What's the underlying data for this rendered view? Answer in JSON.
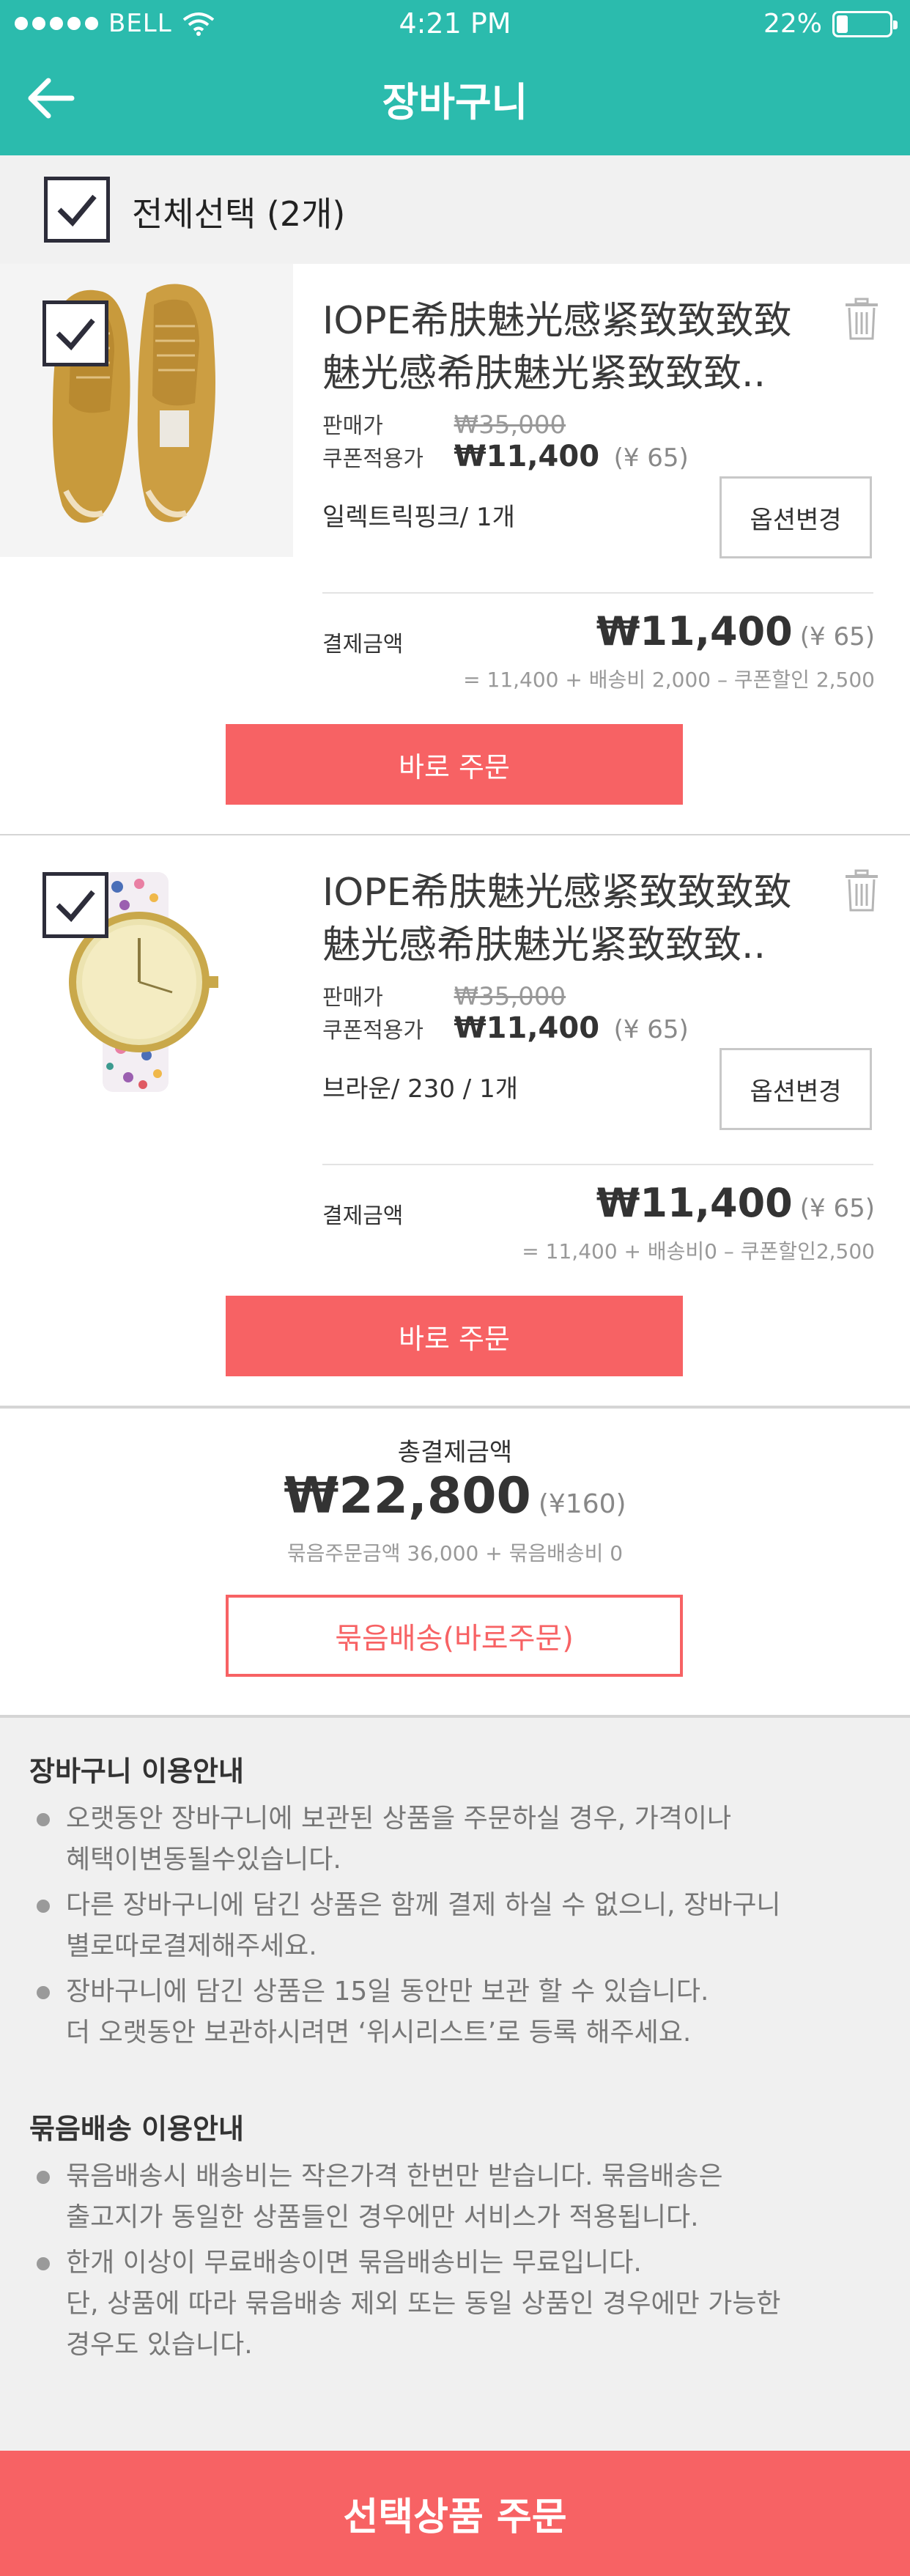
{
  "status_bar": {
    "carrier": "BELL",
    "time": "4:21 PM",
    "battery": "22%",
    "battery_level": 0.22
  },
  "header": {
    "title": "장바구니"
  },
  "select_all": {
    "label": "전체선택 (2개)",
    "checked": true
  },
  "items": [
    {
      "checked": true,
      "name_line1": "IOPE希肤魅光感紧致致致致",
      "name_line2": "魅光感希肤魅光紧致致致..",
      "sale_label": "판매가",
      "original_price": "₩35,000",
      "coupon_label": "쿠폰적용가",
      "coupon_price": "₩11,400",
      "coupon_yen": "(¥ 65)",
      "option": "일렉트릭핑크/ 1개",
      "option_button": "옵션변경",
      "pay_label": "결제금액",
      "pay_amount": "₩11,400",
      "pay_yen": "(¥ 65)",
      "pay_breakdown": "= 11,400 + 배송비 2,000 – 쿠폰할인 2,500",
      "order_button": "바로 주문",
      "image": "shoes"
    },
    {
      "checked": true,
      "name_line1": "IOPE希肤魅光感紧致致致致",
      "name_line2": "魅光感希肤魅光紧致致致..",
      "sale_label": "판매가",
      "original_price": "₩35,000",
      "coupon_label": "쿠폰적용가",
      "coupon_price": "₩11,400",
      "coupon_yen": "(¥ 65)",
      "option": "브라운/ 230 / 1개",
      "option_button": "옵션변경",
      "pay_label": "결제금액",
      "pay_amount": "₩11,400",
      "pay_yen": "(¥ 65)",
      "pay_breakdown": "= 11,400 + 배송비0 – 쿠폰할인2,500",
      "order_button": "바로 주문",
      "image": "watch"
    }
  ],
  "total": {
    "label": "총결제금액",
    "amount": "₩22,800",
    "yen": "(¥160)",
    "breakdown": "묶음주문금액 36,000 + 묶음배송비 0",
    "bundle_button": "묶음배송(바로주문)"
  },
  "cart_guide": {
    "title": "장바구니 이용안내",
    "items": [
      [
        "오랫동안 장바구니에 보관된 상품을 주문하실 경우, 가격이나",
        "혜택이변동될수있습니다."
      ],
      [
        "다른 장바구니에 담긴 상품은 함께 결제 하실 수 없으니, 장바구니",
        "별로따로결제해주세요."
      ],
      [
        "장바구니에 담긴 상품은 15일 동안만 보관 할 수 있습니다.",
        "더 오랫동안 보관하시려면 ‘위시리스트’로 등록 해주세요."
      ]
    ]
  },
  "bundle_guide": {
    "title": "묶음배송 이용안내",
    "items": [
      [
        "묶음배송시 배송비는 작은가격 한번만 받습니다. 묶음배송은",
        "출고지가 동일한 상품들인 경우에만 서비스가 적용됩니다."
      ],
      [
        "한개 이상이 무료배송이면 묶음배송비는 무료입니다.",
        "단, 상품에 따라 묶음배송 제외 또는 동일 상품인 경우에만 가능한",
        "경우도 있습니다."
      ]
    ]
  },
  "bottom_button": "선택상품 주문",
  "colors": {
    "header": "#2bbbad",
    "accent": "#f76264",
    "background_gray": "#f0f0f0"
  },
  "icons": [
    "back-arrow-icon",
    "wifi-icon",
    "battery-icon",
    "check-icon",
    "trash-icon"
  ]
}
